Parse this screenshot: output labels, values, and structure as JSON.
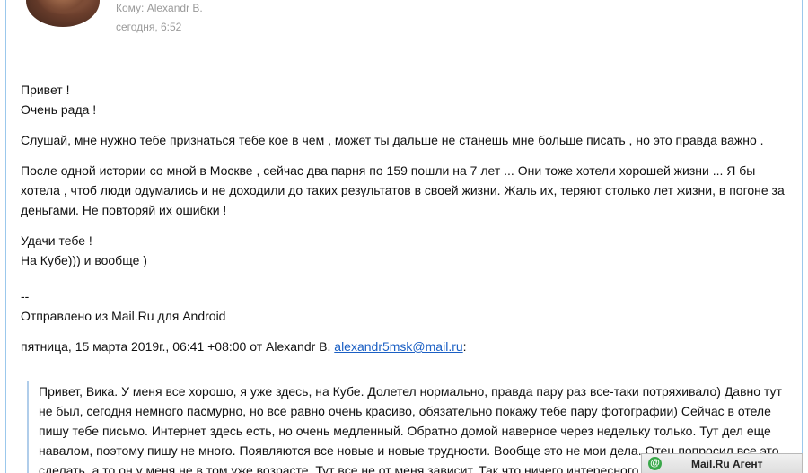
{
  "header": {
    "to_line": "Кому: Alexandr B.",
    "time": "сегодня, 6:52"
  },
  "message": {
    "greeting": [
      "Привет !",
      "Очень рада !"
    ],
    "p1": "Слушай, мне нужно тебе признаться тебе кое в чем , может ты дальше не станешь мне больше писать , но это правда важно .",
    "p2": "После одной истории со мной в Москве , сейчас два парня по 159 пошли на 7 лет ... Они тоже хотели хорошей жизни ... Я бы хотела , чтоб люди одумались и не доходили до таких результатов в своей жизни.  Жаль их, теряют столько лет жизни, в погоне за деньгами.  Не повторяй их ошибки !",
    "closing": [
      "Удачи тебе !",
      "На Кубе))) и вообще )"
    ],
    "sig_sep": "--",
    "signature": "Отправлено из Mail.Ru для Android",
    "reply_header": "пятница, 15 марта 2019г., 06:41 +08:00 от Alexandr B. ",
    "reply_email": "alexandr5msk@mail.ru",
    "reply_colon": ":"
  },
  "quote": {
    "text": "Привет, Вика. У меня все хорошо, я уже здесь, на Кубе. Долетел нормально, правда пару раз все-таки потряхивало) Давно тут не был, сегодня немного пасмурно, но все равно очень красиво, обязательно покажу тебе пару фотографии) Сейчас в отеле пишу тебе письмо. Интернет здесь есть, но очень медленный. Обратно домой наверное через недельку только. Тут дел еще навалом, поэтому пишу не много. Появляются все новые и новые трудности. Вообще это не мои дела. Отец попросил все это сделать, а то он у меня не в том уже возрасте. Тут все не от меня зависит. Так что ничего интересного"
  },
  "agent_bar": {
    "icon": "mailru-at-icon",
    "label": "Mail.Ru Агент",
    "accent": "#3aa84a"
  }
}
